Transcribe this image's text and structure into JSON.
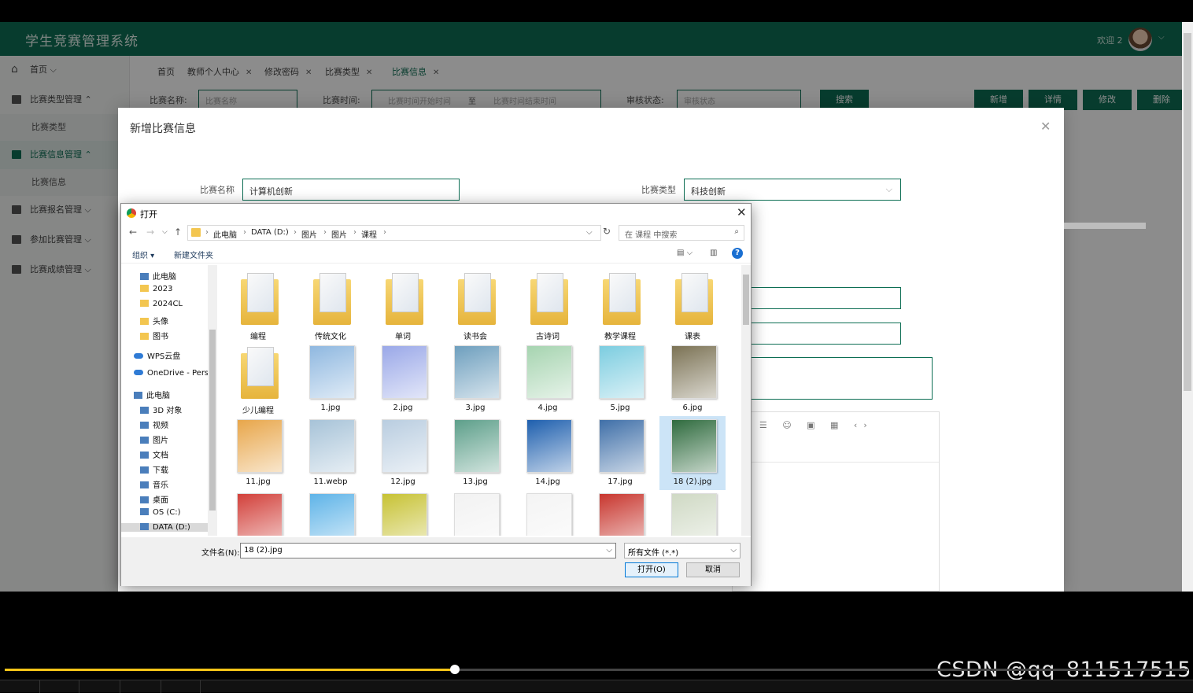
{
  "app": {
    "title": "学生竞赛管理系统",
    "welcome": "欢迎 2"
  },
  "sidebar": {
    "items": [
      {
        "label": "首页",
        "icon": "home-icon"
      },
      {
        "label": "比赛类型管理",
        "icon": "grid-icon"
      },
      {
        "label": "比赛类型",
        "sub": true
      },
      {
        "label": "比赛信息管理",
        "icon": "grid-icon",
        "active": true
      },
      {
        "label": "比赛信息",
        "sub": true
      },
      {
        "label": "比赛报名管理",
        "icon": "grid-icon"
      },
      {
        "label": "参加比赛管理",
        "icon": "grid-icon"
      },
      {
        "label": "比赛成绩管理",
        "icon": "grid-icon"
      }
    ]
  },
  "tabs": [
    {
      "label": "首页",
      "closable": false
    },
    {
      "label": "教师个人中心",
      "closable": true
    },
    {
      "label": "修改密码",
      "closable": true
    },
    {
      "label": "比赛类型",
      "closable": true
    },
    {
      "label": "比赛信息",
      "closable": true,
      "active": true
    }
  ],
  "filter": {
    "name_label": "比赛名称:",
    "name_placeholder": "比赛名称",
    "time_label": "比赛时间:",
    "time_start_placeholder": "比赛时间开始时间",
    "time_sep": "至",
    "time_end_placeholder": "比赛时间结束时间",
    "status_label": "审核状态:",
    "status_placeholder": "审核状态",
    "search_btn": "搜索",
    "add_btn": "新增",
    "detail_btn": "详情",
    "edit_btn": "修改",
    "delete_btn": "删除"
  },
  "modal": {
    "title": "新增比赛信息",
    "name_label": "比赛名称",
    "name_value": "计算机创新",
    "type_label": "比赛类型",
    "type_value": "科技创新"
  },
  "dialog": {
    "title": "打开",
    "breadcrumb": [
      "此电脑",
      "DATA (D:)",
      "图片",
      "图片",
      "课程"
    ],
    "search_placeholder": "在 课程 中搜索",
    "organize": "组织 ▾",
    "new_folder": "新建文件夹",
    "nav_items": [
      {
        "label": "此电脑",
        "kind": "desktop-icon"
      },
      {
        "label": "2023",
        "kind": "folder-icon"
      },
      {
        "label": "2024CL",
        "kind": "folder-icon"
      },
      {
        "label": "头像",
        "kind": "folder-icon"
      },
      {
        "label": "图书",
        "kind": "folder-icon"
      },
      {
        "label": "WPS云盘",
        "kind": "cloud-icon"
      },
      {
        "label": "OneDrive - Pers",
        "kind": "cloud-icon"
      },
      {
        "label": "此电脑",
        "kind": "computer-icon"
      },
      {
        "label": "3D 对象",
        "kind": "drive-icon"
      },
      {
        "label": "视频",
        "kind": "drive-icon"
      },
      {
        "label": "图片",
        "kind": "drive-icon"
      },
      {
        "label": "文档",
        "kind": "drive-icon"
      },
      {
        "label": "下载",
        "kind": "drive-icon"
      },
      {
        "label": "音乐",
        "kind": "drive-icon"
      },
      {
        "label": "桌面",
        "kind": "drive-icon"
      },
      {
        "label": "OS (C:)",
        "kind": "drive-icon"
      },
      {
        "label": "DATA (D:)",
        "kind": "drive-icon",
        "selected": true
      }
    ],
    "files": [
      {
        "label": "编程",
        "type": "folder"
      },
      {
        "label": "传统文化",
        "type": "folder"
      },
      {
        "label": "单词",
        "type": "folder"
      },
      {
        "label": "读书会",
        "type": "folder"
      },
      {
        "label": "古诗词",
        "type": "folder"
      },
      {
        "label": "教学课程",
        "type": "folder"
      },
      {
        "label": "课表",
        "type": "folder"
      },
      {
        "label": "少儿编程",
        "type": "folder"
      },
      {
        "label": "1.jpg",
        "type": "image",
        "color": "#8fb8e0"
      },
      {
        "label": "2.jpg",
        "type": "image",
        "color": "#9aa8e8"
      },
      {
        "label": "3.jpg",
        "type": "image",
        "color": "#6e9fbe"
      },
      {
        "label": "4.jpg",
        "type": "image",
        "color": "#a6d4b0"
      },
      {
        "label": "5.jpg",
        "type": "image",
        "color": "#7ccde0"
      },
      {
        "label": "6.jpg",
        "type": "image",
        "color": "#7b7254"
      },
      {
        "label": "11.jpg",
        "type": "image",
        "color": "#e8a64a"
      },
      {
        "label": "11.webp",
        "type": "image",
        "color": "#a7c3d8"
      },
      {
        "label": "12.jpg",
        "type": "image",
        "color": "#b9cde0"
      },
      {
        "label": "13.jpg",
        "type": "image",
        "color": "#5d9f8a"
      },
      {
        "label": "14.jpg",
        "type": "image",
        "color": "#1e5fae"
      },
      {
        "label": "17.jpg",
        "type": "image",
        "color": "#3f6fa8"
      },
      {
        "label": "18 (2).jpg",
        "type": "image",
        "color": "#2f6b3e",
        "selected": true
      },
      {
        "label": "",
        "type": "image",
        "color": "#d2403a"
      },
      {
        "label": "",
        "type": "image",
        "color": "#5fb4e8"
      },
      {
        "label": "",
        "type": "image",
        "color": "#c7c234"
      },
      {
        "label": "",
        "type": "image",
        "color": "#f2f2f2"
      },
      {
        "label": "",
        "type": "image",
        "color": "#f4f4f4"
      },
      {
        "label": "",
        "type": "image",
        "color": "#c8362e"
      },
      {
        "label": "",
        "type": "image",
        "color": "#cfd9c4"
      }
    ],
    "filename_label": "文件名(N):",
    "filename_value": "18 (2).jpg",
    "filetype_value": "所有文件 (*.*)",
    "open_btn": "打开(O)",
    "cancel_btn": "取消"
  },
  "watermark": "CSDN @qq_811517515",
  "player": {
    "progress": 0.38
  }
}
